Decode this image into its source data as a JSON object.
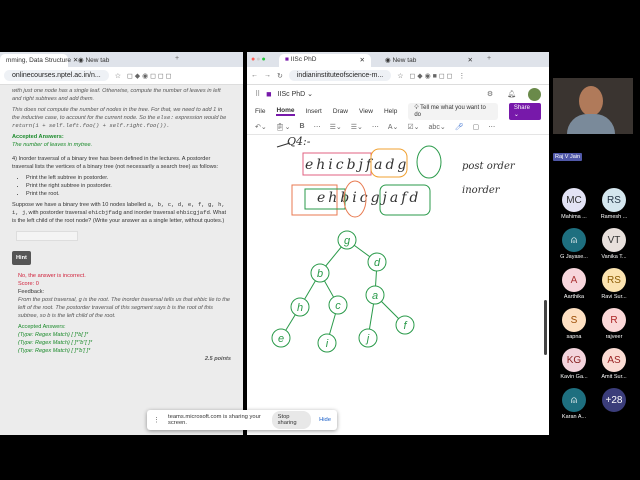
{
  "left_browser": {
    "tabs": [
      "mming, Data Structure",
      "New tab"
    ],
    "url": "onlinecourses.nptel.ac.in/n...",
    "content": {
      "prev_feedback1": "with just one node has a single leaf. Otherwise, compute the number of leaves in left and right subtrees and add them.",
      "prev_feedback2a": "This does not compute the number of nodes in the tree. For that, we need to add 1 in the inductive case, to account for the current node. So the ",
      "prev_feedback2b": "else:",
      "prev_feedback2c": " expression would be ",
      "prev_feedback2d": "return(1 + self.left.foo() + self.right.foo()).",
      "prev_accepted_label": "Accepted Answers:",
      "prev_accepted": "The number of leaves in mytree.",
      "q4_intro": "4)  Inorder traversal of a binary tree has been defined in the lectures. A postorder traversal lists the vertices of a binary tree (not necessarily a search tree) as follows:",
      "q4_bullets": [
        "Print the left subtree in postorder.",
        "Print the right subtree in postorder.",
        "Print the root."
      ],
      "q4_text_a": "Suppose we have a binary tree with 10 nodes labelled ",
      "q4_labels": "a, b, c, d, e, f, g, h, i, j",
      "q4_text_b": ", with postorder traversal ",
      "q4_post": "ehicbjfadg",
      "q4_text_c": " and inorder traversal ",
      "q4_in": "ehbicgjafd",
      "q4_text_d": ". What is the left child of the root node? (Write your answer as a single letter, without quotes.)",
      "hint": "Hint",
      "result": "No, the answer is incorrect.",
      "score": "Score: 0",
      "feedback_label": "Feedback:",
      "feedback": "From the post traversal, g is the root. The inorder traversal tells us that ehbic lie to the left of the root. The postorder traversal of this segment says b is the root of this subtree, so b is the left child of the root.",
      "accepted_label": "Accepted Answers:",
      "accepted": [
        "(Type: Regex Match) [ ]*b[ ]*",
        "(Type: Regex Match) [ ]*\"b\"[ ]*",
        "(Type: Regex Match) [ ]*'b'[ ]*"
      ],
      "points": "2.5 points"
    }
  },
  "right_browser": {
    "tabs": [
      "IISc PhD",
      "New tab"
    ],
    "url": "indianinstituteofscience-m...",
    "notebook": "IISc PhD ⌄",
    "menus": [
      "File",
      "Home",
      "Insert",
      "Draw",
      "View",
      "Help"
    ],
    "tell_me": "Tell me what you want to do",
    "share": "Share ⌄",
    "ink": {
      "q": "Q4:-",
      "post": "ehicbjfadg",
      "post_label": "post order",
      "in": "ehbicgjafd",
      "in_label": "inorder",
      "tree": [
        "g",
        "b",
        "d",
        "h",
        "c",
        "a",
        "e",
        "i",
        "j",
        "f"
      ]
    }
  },
  "teams": {
    "presenter": "Raj V Jain",
    "participants": [
      {
        "i": "MC",
        "n": "Mahima ...",
        "bg": "#e3e3f5",
        "c": "#333"
      },
      {
        "i": "RS",
        "n": "Ramesh ...",
        "bg": "#d4e6ee",
        "c": "#234"
      },
      {
        "i": "",
        "n": "G Jayase...",
        "bg": "#1e6f7f",
        "c": "#fff"
      },
      {
        "i": "VT",
        "n": "Vanika T...",
        "bg": "#e8e0dc",
        "c": "#333"
      },
      {
        "i": "A",
        "n": "Aarthika",
        "bg": "#f7d6dc",
        "c": "#a33"
      },
      {
        "i": "RS",
        "n": "Ravi Sur...",
        "bg": "#fbe3b0",
        "c": "#8a5a00"
      },
      {
        "i": "S",
        "n": "sapna",
        "bg": "#fde0c2",
        "c": "#9a4a00"
      },
      {
        "i": "R",
        "n": "rajveer",
        "bg": "#fbd8d8",
        "c": "#a22"
      },
      {
        "i": "KG",
        "n": "Kavin Ga...",
        "bg": "#f3d4dc",
        "c": "#822"
      },
      {
        "i": "AS",
        "n": "Amit Sur...",
        "bg": "#fbdcd4",
        "c": "#922"
      },
      {
        "i": "",
        "n": "Karan A...",
        "bg": "#1e6f7f",
        "c": "#fff"
      },
      {
        "i": "+28",
        "n": "",
        "bg": "#3b3d7a",
        "c": "#fff"
      }
    ]
  },
  "share_bar": {
    "text": "teams.microsoft.com is sharing your screen.",
    "stop": "Stop sharing",
    "hide": "Hide"
  }
}
